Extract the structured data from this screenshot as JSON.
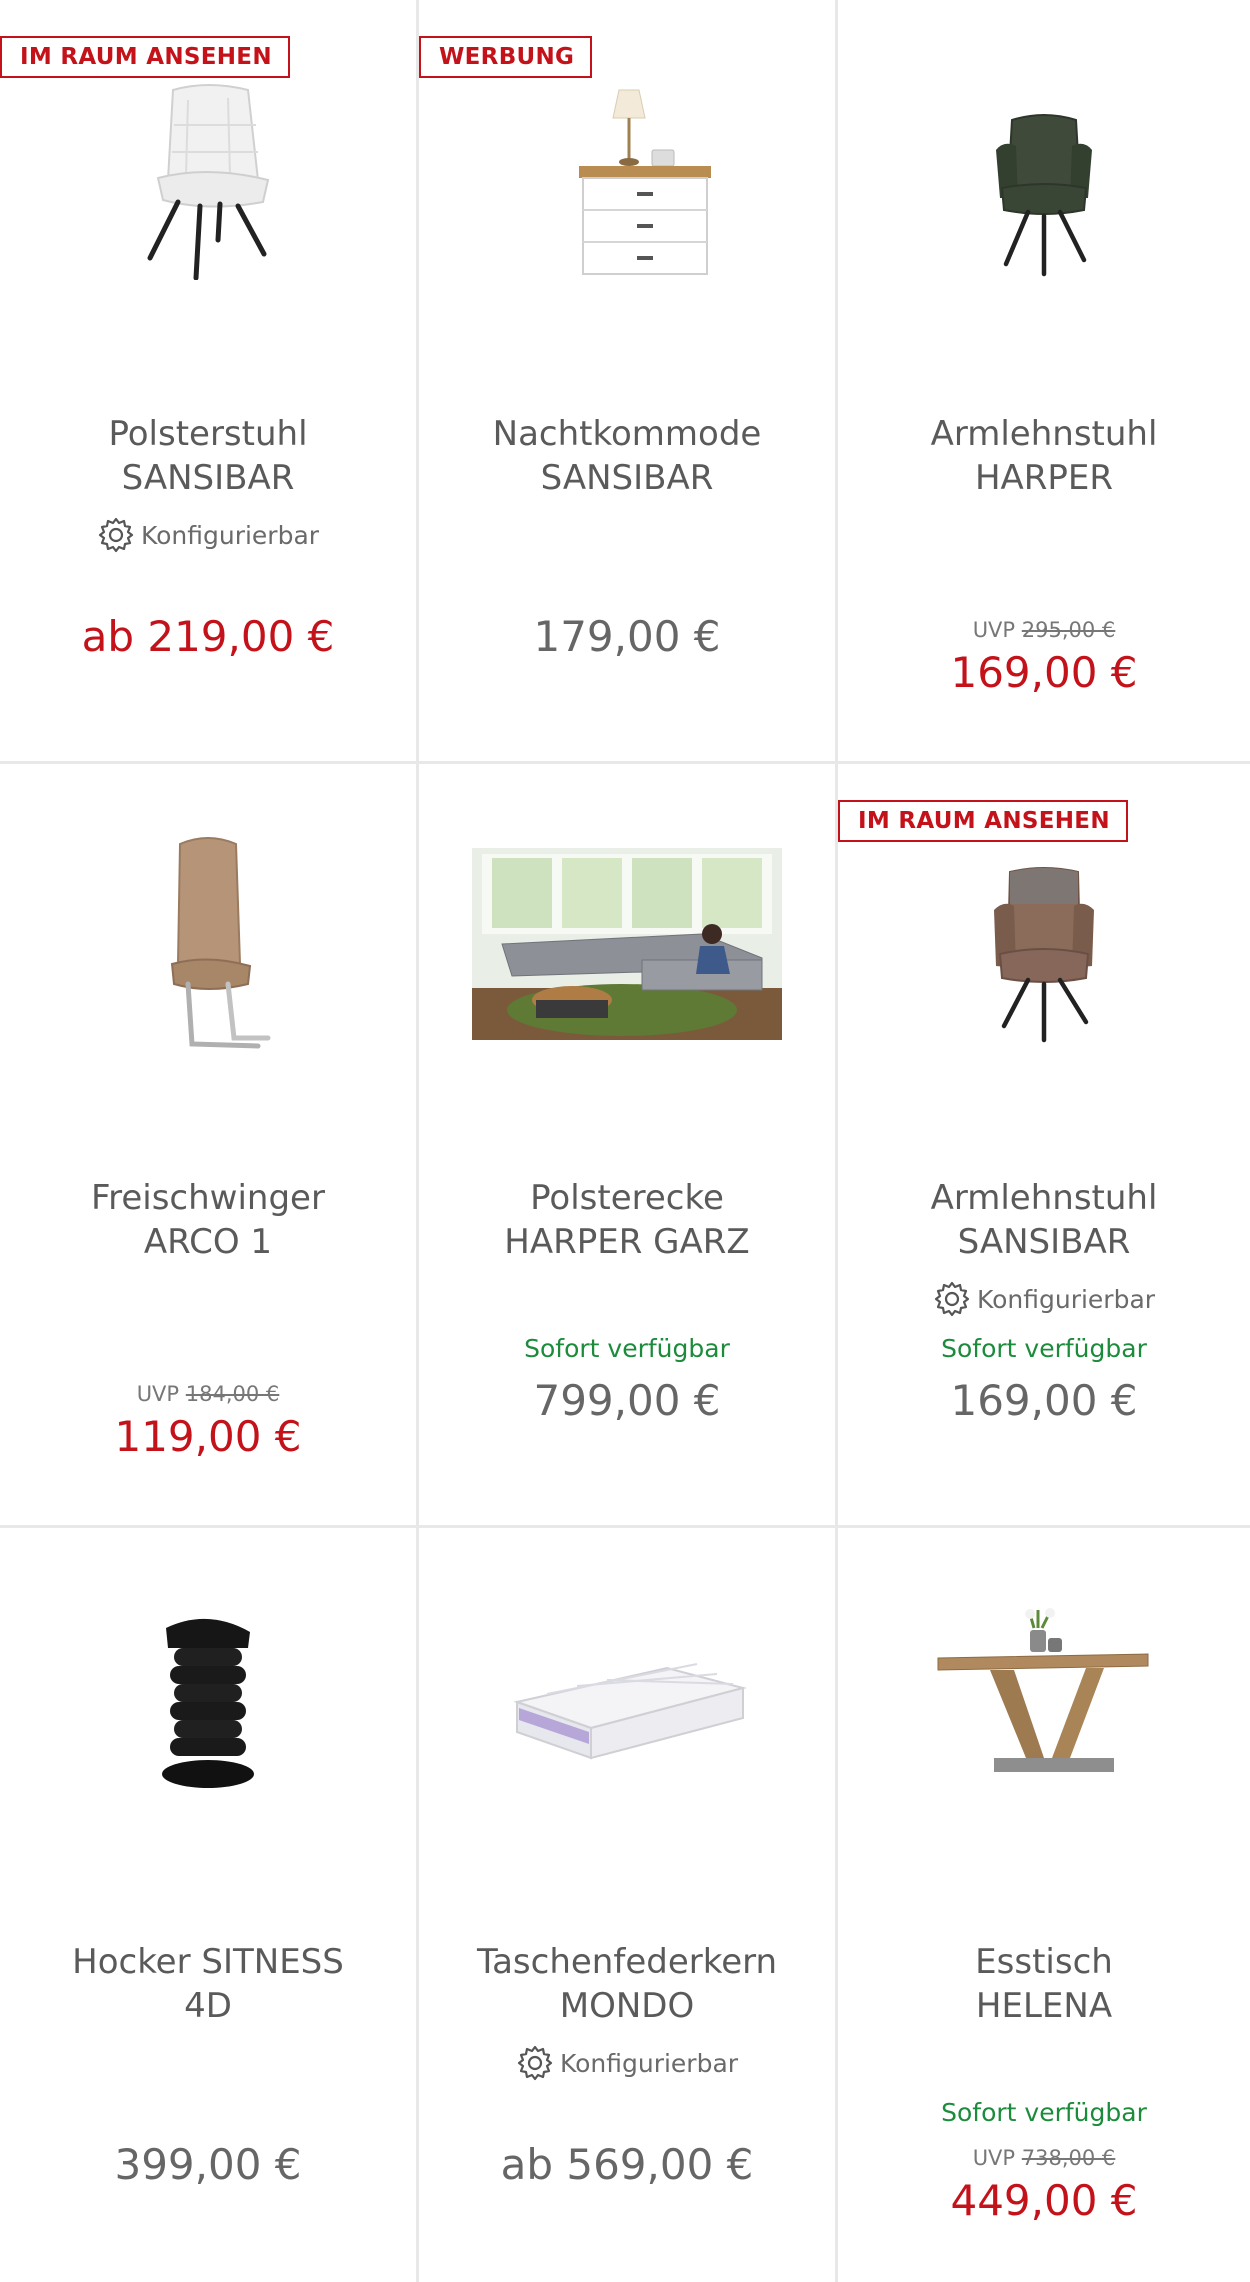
{
  "colors": {
    "sale_red": "#c4121a",
    "available_green": "#1c8c3c",
    "text_grey": "#5a5a5a"
  },
  "products": [
    {
      "badge": "IM RAUM ANSEHEN",
      "image_icon": "upholstered-chair-white",
      "title_line1": "Polsterstuhl",
      "title_line2": "SANSIBAR",
      "configurable": "Konfigurierbar",
      "price": "ab 219,00 €"
    },
    {
      "badge": "WERBUNG",
      "image_icon": "nightstand-with-lamp",
      "title_line1": "Nachtkommode",
      "title_line2": "SANSIBAR",
      "price": "179,00 €"
    },
    {
      "image_icon": "armchair-green",
      "title_line1": "Armlehnstuhl",
      "title_line2": "HARPER",
      "uvp_label": "UVP",
      "uvp_price": "295,00 €",
      "price": "169,00 €"
    },
    {
      "image_icon": "cantilever-chair-taupe",
      "title_line1": "Freischwinger",
      "title_line2": "ARCO 1",
      "uvp_label": "UVP",
      "uvp_price": "184,00 €",
      "price": "119,00 €"
    },
    {
      "image_icon": "corner-sofa-photo",
      "title_line1": "Polsterecke",
      "title_line2": "HARPER GARZ",
      "availability": "Sofort verfügbar",
      "price": "799,00 €"
    },
    {
      "badge": "IM RAUM ANSEHEN",
      "image_icon": "armchair-brown",
      "title_line1": "Armlehnstuhl",
      "title_line2": "SANSIBAR",
      "configurable": "Konfigurierbar",
      "availability": "Sofort verfügbar",
      "price": "169,00 €"
    },
    {
      "image_icon": "stool-black",
      "title_line1": "Hocker SITNESS",
      "title_line2": "4D",
      "price": "399,00 €"
    },
    {
      "image_icon": "mattress",
      "title_line1": "Taschenfederkern",
      "title_line2": "MONDO",
      "configurable": "Konfigurierbar",
      "price": "ab 569,00 €"
    },
    {
      "image_icon": "dining-table",
      "title_line1": "Esstisch",
      "title_line2": "HELENA",
      "availability": "Sofort verfügbar",
      "uvp_label": "UVP",
      "uvp_price": "738,00 €",
      "price": "449,00 €"
    }
  ]
}
